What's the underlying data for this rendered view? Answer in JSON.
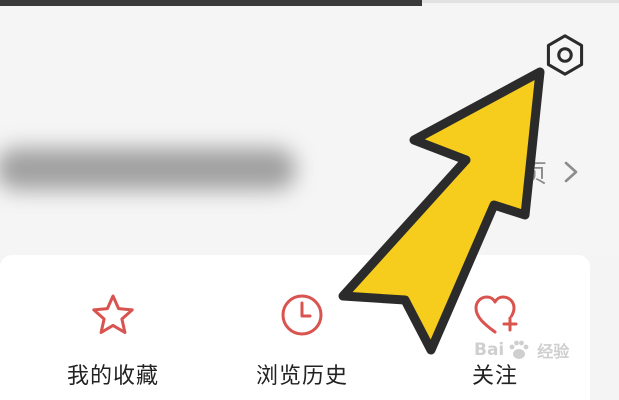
{
  "header": {
    "homepage_link_label": "页"
  },
  "quick_actions": [
    {
      "label": "我的收藏",
      "icon": "star-icon"
    },
    {
      "label": "浏览历史",
      "icon": "clock-icon"
    },
    {
      "label": "关注",
      "icon": "heart-plus-icon"
    }
  ],
  "watermark": {
    "brand_a": "Bai",
    "brand_b": "经验"
  },
  "colors": {
    "accent_red": "#d9534f",
    "arrow_yellow": "#f6cd1c",
    "arrow_outline": "#2b2b2b"
  }
}
